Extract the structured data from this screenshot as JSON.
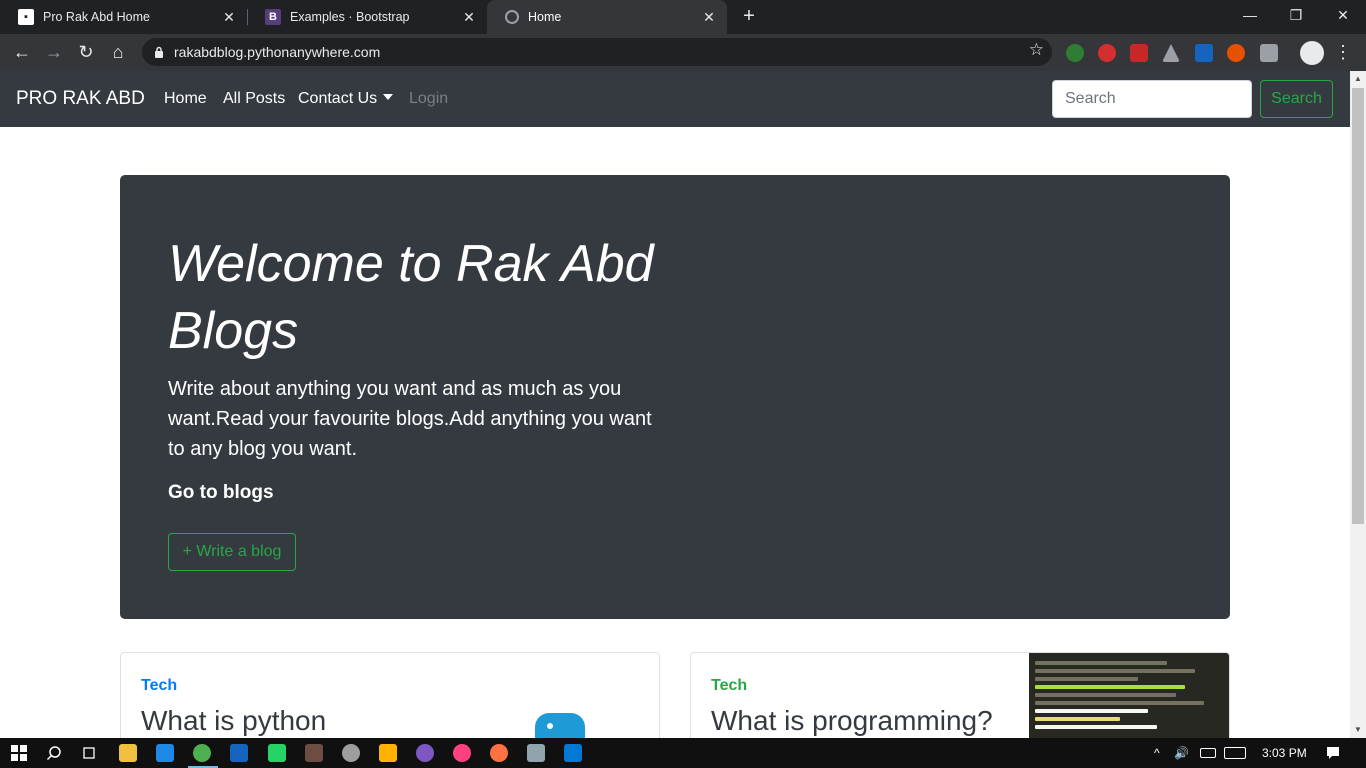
{
  "browser": {
    "tabs": [
      {
        "title": "Pro Rak Abd Home",
        "favicon": "doc-favicon-icon"
      },
      {
        "title": "Examples · Bootstrap",
        "favicon": "bootstrap-favicon-icon",
        "favicon_text": "B"
      },
      {
        "title": "Home",
        "favicon": "globe-favicon-icon",
        "active": true
      }
    ],
    "url": "rakabdblog.pythonanywhere.com",
    "window_controls": {
      "minimize": "—",
      "maximize": "❐",
      "close": "✕"
    },
    "new_tab": "+",
    "close_glyph": "✕",
    "nav_glyphs": {
      "back": "←",
      "forward": "→",
      "reload": "↻",
      "home": "⌂",
      "star": "☆",
      "menu": "⋮"
    },
    "extension_colors": [
      "#2e7d32",
      "#d32f2f",
      "#c62828",
      "#9aa0a6",
      "#1565c0",
      "#e65100",
      "#9aa0a6"
    ]
  },
  "navbar": {
    "brand": "PRO RAK ABD",
    "links": [
      "Home",
      "All Posts",
      "Contact Us",
      "Login"
    ],
    "search_placeholder": "Search",
    "search_button": "Search"
  },
  "hero": {
    "title": "Welcome to Rak Abd Blogs",
    "lead": "Write about anything you want and as much as you want.Read your favourite blogs.Add anything you want to any blog you want.",
    "goto_text": "Go to blogs",
    "write_button": "+ Write a blog"
  },
  "cards": [
    {
      "category": "Tech",
      "category_color": "#007bff",
      "title": "What is python"
    },
    {
      "category": "Tech",
      "category_color": "#28a745",
      "title": "What is programming?"
    }
  ],
  "taskbar": {
    "time": "3:03 PM",
    "tray_glyphs": {
      "chevron": "^",
      "volume": "🔊"
    },
    "app_colors": [
      "#f0c040",
      "#1e88e5",
      "#4caf50",
      "#1565c0",
      "#25d366",
      "#6d4c41",
      "#9e9e9e",
      "#ffb300",
      "#7e57c2",
      "#ff4081",
      "#ff7043",
      "#90a4ae",
      "#0078d4"
    ]
  },
  "colors": {
    "navbar_bg": "#343a40",
    "success": "#28a745",
    "primary": "#007bff"
  }
}
